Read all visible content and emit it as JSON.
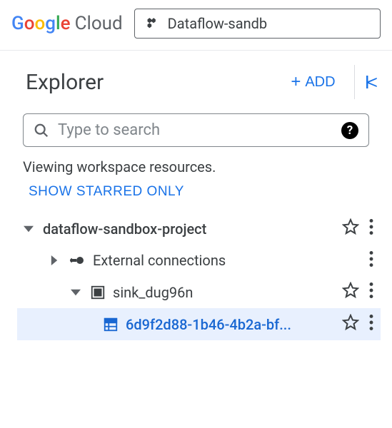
{
  "header": {
    "logo_text_google": "Google",
    "logo_text_cloud": "Cloud",
    "project_name": "Dataflow-sandb"
  },
  "explorer": {
    "title": "Explorer",
    "add_label": "ADD",
    "search_placeholder": "Type to search",
    "info_text": "Viewing workspace resources.",
    "starred_label": "SHOW STARRED ONLY"
  },
  "tree": {
    "items": [
      {
        "label": "dataflow-sandbox-project",
        "expanded": true,
        "icon": "none",
        "starred": false,
        "has_star": true,
        "indent": 0
      },
      {
        "label": "External connections",
        "expanded": false,
        "icon": "external",
        "starred": false,
        "has_star": false,
        "indent": 1
      },
      {
        "label": "sink_dug96n",
        "expanded": true,
        "icon": "dataset",
        "starred": false,
        "has_star": true,
        "indent": 2
      },
      {
        "label": "6d9f2d88-1b46-4b2a-bf...",
        "expanded": null,
        "icon": "table",
        "starred": false,
        "has_star": true,
        "indent": 3,
        "selected": true
      }
    ]
  }
}
